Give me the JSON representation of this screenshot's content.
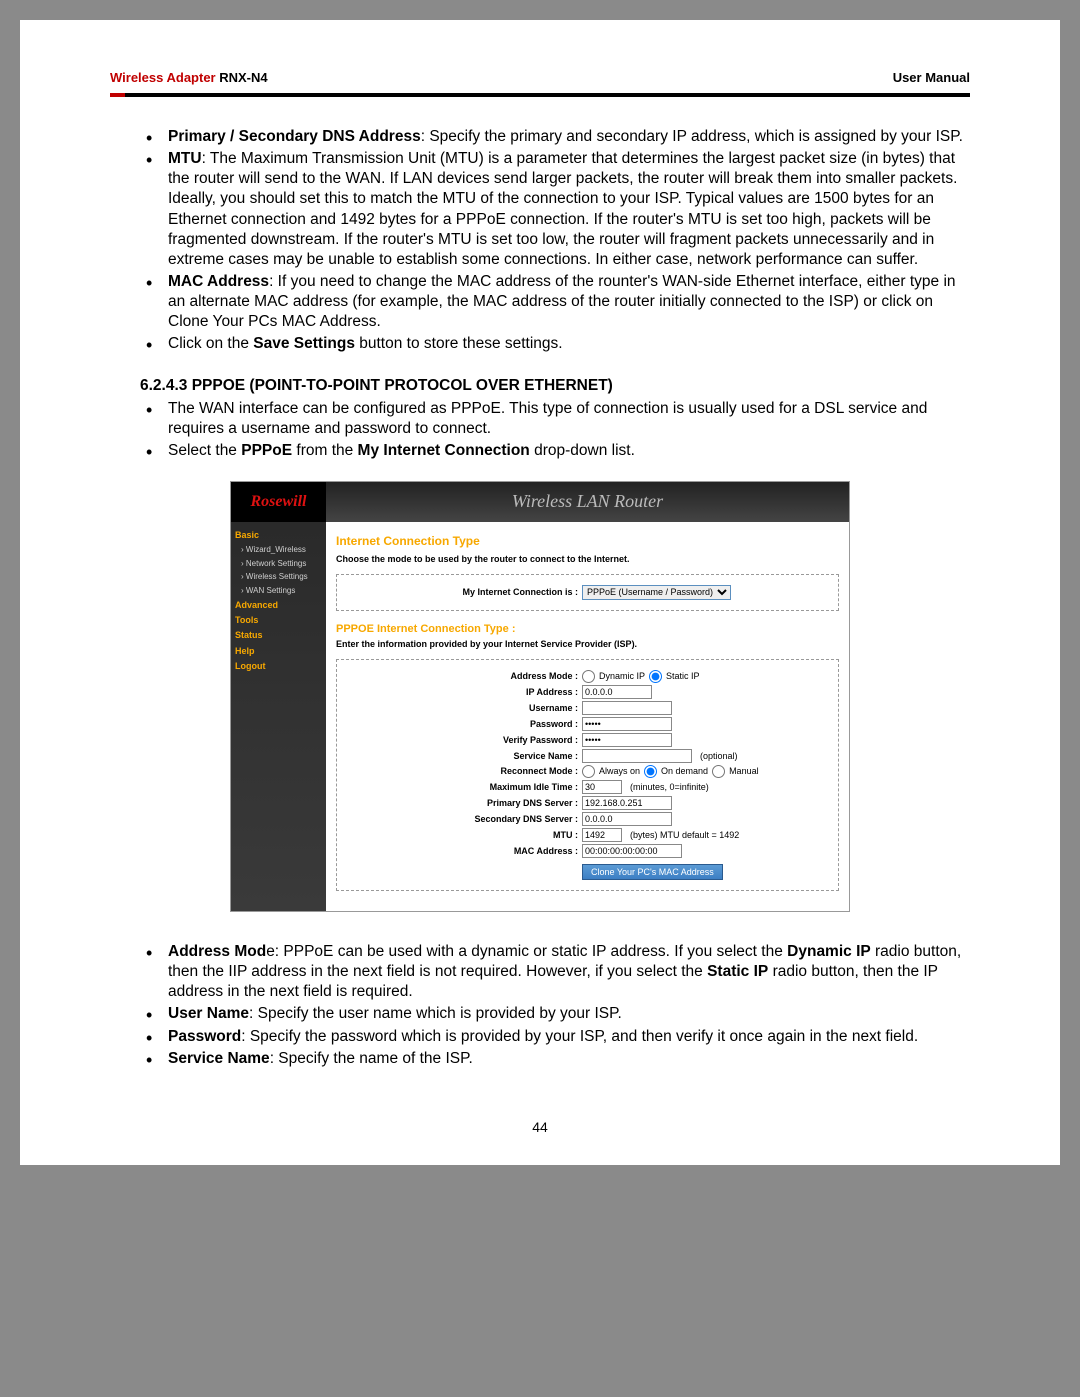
{
  "header": {
    "brand": "Wireless Adapter",
    "model": "RNX-N4",
    "right": "User Manual"
  },
  "bullets_top": [
    {
      "bold": "Primary / Secondary DNS Address",
      "text": ": Specify the primary and secondary IP address, which is assigned by your ISP."
    },
    {
      "bold": "MTU",
      "text": ": The Maximum Transmission Unit (MTU) is a parameter that determines the largest packet size (in bytes) that the router will send to the WAN. If LAN devices send larger packets, the router will break them into smaller packets. Ideally, you should set this to match the MTU of the connection to your ISP. Typical values are 1500 bytes for an Ethernet connection and 1492 bytes for a PPPoE connection. If the router's MTU is set too high, packets will be fragmented downstream. If the router's MTU is set too low, the router will fragment packets unnecessarily and in extreme cases may be unable to establish some connections. In either case, network performance can suffer."
    },
    {
      "bold": "MAC Address",
      "text": ": If you need to change the MAC address of the rounter's WAN-side Ethernet interface, either type in an alternate MAC address (for example, the MAC address of the router initially connected to the ISP) or click on Clone Your PCs MAC Address."
    },
    {
      "pre": "Click on the ",
      "bold": "Save Settings",
      "text": " button to store these settings."
    }
  ],
  "section_heading": "6.2.4.3  PPPOE (POINT-TO-POINT PROTOCOL OVER ETHERNET)",
  "bullets_mid": [
    {
      "text": "The WAN interface can be configured as PPPoE. This type of connection is usually used for a DSL service and requires a username and password to connect."
    },
    {
      "pre": "Select the ",
      "bold": "PPPoE",
      "mid": " from the ",
      "bold2": "My Internet Connection",
      "text": " drop-down list."
    }
  ],
  "router_ui": {
    "logo": "Rosewill",
    "title": "Wireless LAN Router",
    "sidebar": {
      "basic": "Basic",
      "wizard": "› Wizard_Wireless",
      "network": "› Network Settings",
      "wireless": "› Wireless Settings",
      "wan": "› WAN Settings",
      "advanced": "Advanced",
      "tools": "Tools",
      "status": "Status",
      "help": "Help",
      "logout": "Logout"
    },
    "content": {
      "h1": "Internet Connection Type",
      "help1": "Choose the mode to be used by the router to connect to the Internet.",
      "conn_label": "My Internet Connection is :",
      "conn_value": "PPPoE (Username / Password)",
      "h2": "PPPOE Internet Connection Type :",
      "help2": "Enter the information provided by your Internet Service Provider (ISP).",
      "addr_mode_label": "Address Mode :",
      "addr_dynamic": "Dynamic IP",
      "addr_static": "Static IP",
      "ip_label": "IP Address :",
      "ip_value": "0.0.0.0",
      "user_label": "Username :",
      "pass_label": "Password :",
      "pass_value": "•••••",
      "vpass_label": "Verify Password :",
      "vpass_value": "•••••",
      "svc_label": "Service Name :",
      "svc_hint": "(optional)",
      "reconn_label": "Reconnect Mode :",
      "reconn_always": "Always on",
      "reconn_demand": "On demand",
      "reconn_manual": "Manual",
      "idle_label": "Maximum Idle Time :",
      "idle_value": "30",
      "idle_hint": "(minutes, 0=infinite)",
      "pdns_label": "Primary DNS Server :",
      "pdns_value": "192.168.0.251",
      "sdns_label": "Secondary DNS Server :",
      "sdns_value": "0.0.0.0",
      "mtu_label": "MTU :",
      "mtu_value": "1492",
      "mtu_hint": "(bytes) MTU default = 1492",
      "mac_label": "MAC Address :",
      "mac_value": "00:00:00:00:00:00",
      "clone_btn": "Clone Your PC's MAC Address"
    }
  },
  "bullets_bottom": [
    {
      "bold": "Address Mod",
      "mid": "e: PPPoE can be used with a dynamic or static IP address. If you select the ",
      "bold2": "Dynamic IP",
      "mid2": " radio button, then the IIP address in the next field is not required. However, if you select the ",
      "bold3": "Static IP",
      "text": " radio button, then the IP address in the next field is required."
    },
    {
      "bold": "User Name",
      "text": ": Specify the user name which is provided by your ISP."
    },
    {
      "bold": "Password",
      "text": ": Specify the password which is provided by your ISP, and then verify it once again in the next field."
    },
    {
      "bold": "Service Name",
      "text": ": Specify the name of the ISP."
    }
  ],
  "page_num": "44"
}
